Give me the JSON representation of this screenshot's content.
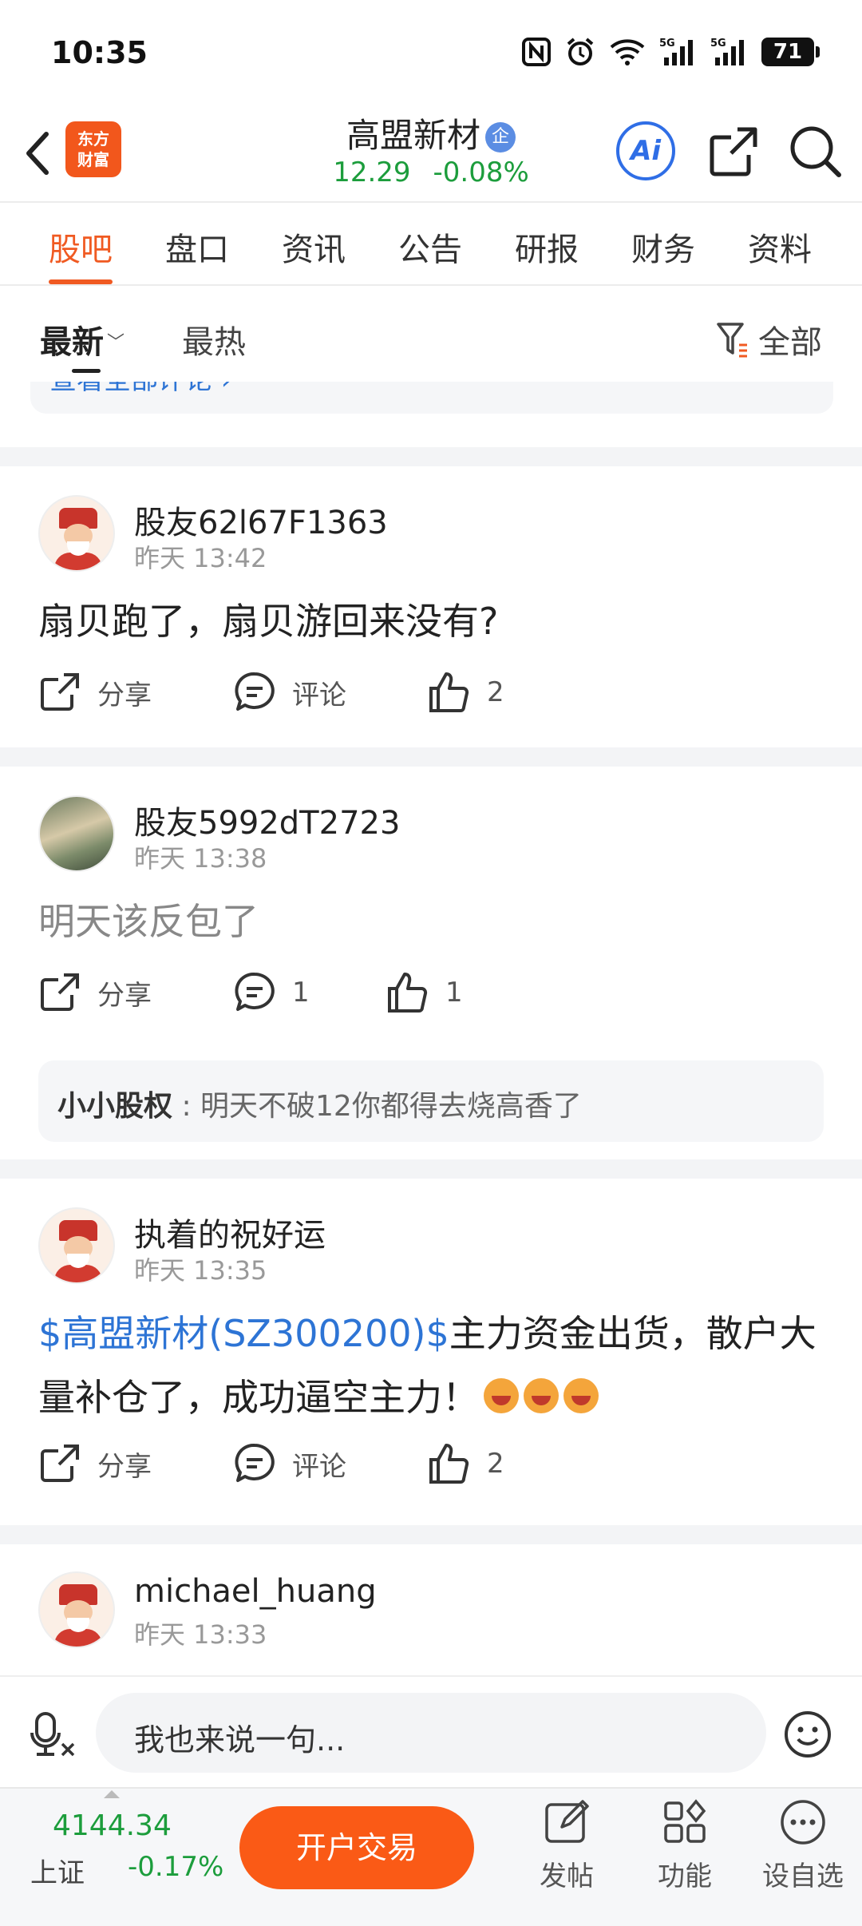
{
  "status": {
    "time": "10:35",
    "battery": "71"
  },
  "header": {
    "logo_line1": "东方",
    "logo_line2": "财富",
    "stock_name": "高盟新材",
    "badge": "企",
    "price": "12.29",
    "change": "-0.08%",
    "ai_label": "Ai"
  },
  "tabs": [
    {
      "label": "股吧",
      "active": true
    },
    {
      "label": "盘口"
    },
    {
      "label": "资讯"
    },
    {
      "label": "公告"
    },
    {
      "label": "研报"
    },
    {
      "label": "财务"
    },
    {
      "label": "资料"
    }
  ],
  "sort": {
    "latest": "最新",
    "hot": "最热",
    "filter": "全部"
  },
  "feed": {
    "partial_link": "查看全部评论 ›",
    "posts": [
      {
        "author": "股友62l67F1363",
        "time": "昨天 13:42",
        "text": "扇贝跑了，扇贝游回来没有?",
        "share": "分享",
        "comment": "评论",
        "likes": "2"
      },
      {
        "author": "股友5992dT2723",
        "time": "昨天 13:38",
        "text": "明天该反包了",
        "share": "分享",
        "comment": "1",
        "likes": "1",
        "reply": {
          "user": "小小股权",
          "text": " : 明天不破12你都得去烧高香了"
        }
      },
      {
        "author": "执着的祝好运",
        "time": "昨天 13:35",
        "tag": "$高盟新材(SZ300200)$",
        "text": "主力资金出货，散户大量补仓了，成功逼空主力！",
        "share": "分享",
        "comment": "评论",
        "likes": "2"
      },
      {
        "author": "michael_huang",
        "time": "昨天 13:33"
      }
    ]
  },
  "input": {
    "placeholder": "我也来说一句..."
  },
  "bottom": {
    "index_value": "4144.34",
    "index_name": "上证",
    "index_change": "-0.17%",
    "trade_button": "开户交易",
    "nav": [
      "发帖",
      "功能",
      "设自选"
    ]
  },
  "colors": {
    "accent": "#f05a22",
    "down": "#1c9d3c",
    "link": "#2d74d5"
  }
}
